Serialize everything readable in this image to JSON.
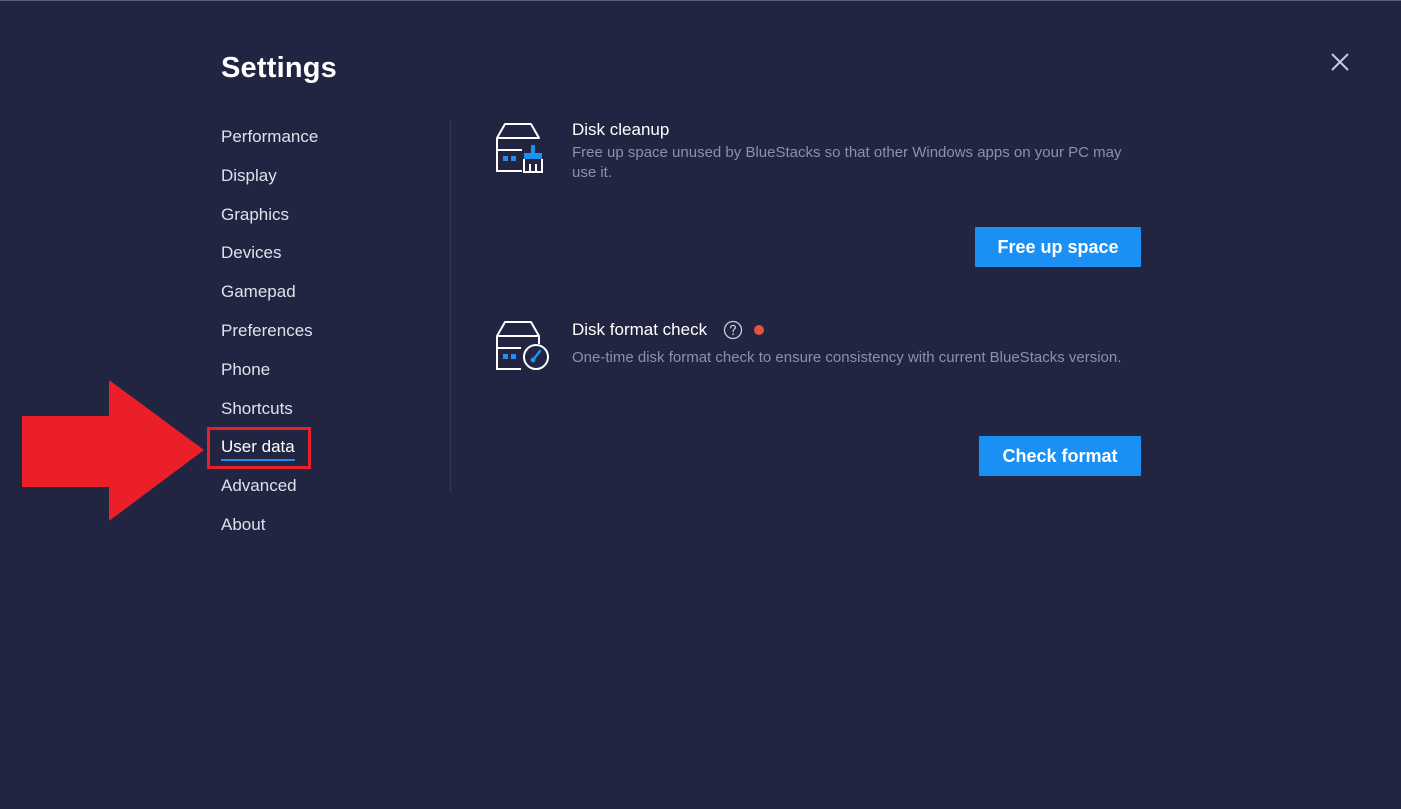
{
  "header": {
    "title": "Settings",
    "close_icon": "close-icon"
  },
  "sidebar": {
    "items": [
      {
        "label": "Performance"
      },
      {
        "label": "Display"
      },
      {
        "label": "Graphics"
      },
      {
        "label": "Devices"
      },
      {
        "label": "Gamepad"
      },
      {
        "label": "Preferences"
      },
      {
        "label": "Phone"
      },
      {
        "label": "Shortcuts"
      },
      {
        "label": "User data",
        "active": true
      },
      {
        "label": "Advanced"
      },
      {
        "label": "About"
      }
    ]
  },
  "main": {
    "disk_cleanup": {
      "icon": "disk-cleanup-icon",
      "title": "Disk cleanup",
      "description": "Free up space unused by BlueStacks so that other Windows apps on your PC may use it.",
      "button_label": "Free up space"
    },
    "disk_format_check": {
      "icon": "disk-format-check-icon",
      "title": "Disk format check",
      "help_icon": "help-circle-icon",
      "status_icon": "notification-dot-icon",
      "description": "One-time disk format check to ensure consistency with current BlueStacks version.",
      "button_label": "Check format"
    }
  },
  "annotation": {
    "arrow_icon": "red-arrow-icon",
    "highlight": "highlight-box"
  },
  "colors": {
    "background": "#212541",
    "accent": "#1a90f5",
    "muted_text": "#8c90a8",
    "annotation_red": "#e8202a",
    "status_dot": "#e5533f"
  }
}
